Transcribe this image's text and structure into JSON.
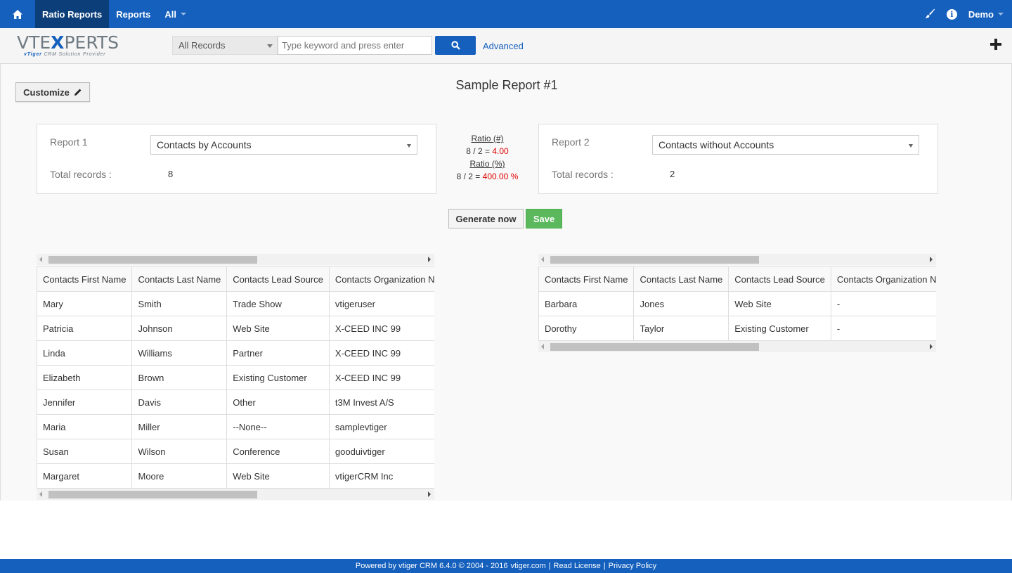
{
  "nav": {
    "tabs": [
      "Ratio Reports",
      "Reports",
      "All"
    ],
    "user": "Demo"
  },
  "subbar": {
    "logo_text_left": "VTE",
    "logo_text_x": "X",
    "logo_text_right": "PERTS",
    "logo_tagline_brand": "vTiger",
    "logo_tagline": "CRM Solution Provider",
    "record_filter": "All Records",
    "search_placeholder": "Type keyword and press enter",
    "advanced_label": "Advanced"
  },
  "page": {
    "customize_label": "Customize",
    "title": "Sample Report #1",
    "generate_label": "Generate now",
    "save_label": "Save"
  },
  "report1": {
    "label": "Report 1",
    "selected": "Contacts by Accounts",
    "total_label": "Total records :",
    "total": "8"
  },
  "report2": {
    "label": "Report 2",
    "selected": "Contacts without Accounts",
    "total_label": "Total records :",
    "total": "2"
  },
  "ratio": {
    "count_label": "Ratio (#)",
    "count_expr": "8 / 2 = ",
    "count_value": "4.00",
    "percent_label": "Ratio (%)",
    "percent_expr": "8 / 2 = ",
    "percent_value": "400.00 %"
  },
  "table1": {
    "columns": [
      "Contacts First Name",
      "Contacts Last Name",
      "Contacts Lead Source",
      "Contacts Organization Name"
    ],
    "rows": [
      [
        "Mary",
        "Smith",
        "Trade Show",
        "vtigeruser"
      ],
      [
        "Patricia",
        "Johnson",
        "Web Site",
        "X-CEED INC 99"
      ],
      [
        "Linda",
        "Williams",
        "Partner",
        "X-CEED INC 99"
      ],
      [
        "Elizabeth",
        "Brown",
        "Existing Customer",
        "X-CEED INC 99"
      ],
      [
        "Jennifer",
        "Davis",
        "Other",
        "t3M Invest A/S"
      ],
      [
        "Maria",
        "Miller",
        "--None--",
        "samplevtiger"
      ],
      [
        "Susan",
        "Wilson",
        "Conference",
        "gooduivtiger"
      ],
      [
        "Margaret",
        "Moore",
        "Web Site",
        "vtigerCRM Inc"
      ]
    ]
  },
  "table2": {
    "columns": [
      "Contacts First Name",
      "Contacts Last Name",
      "Contacts Lead Source",
      "Contacts Organization Name"
    ],
    "rows": [
      [
        "Barbara",
        "Jones",
        "Web Site",
        "-"
      ],
      [
        "Dorothy",
        "Taylor",
        "Existing Customer",
        "-"
      ]
    ]
  },
  "footer": {
    "powered": "Powered by vtiger CRM 6.4.0  © 2004 - 2016",
    "site": "vtiger.com",
    "sep1": "|",
    "license": "Read License",
    "sep2": "|",
    "privacy": "Privacy Policy"
  }
}
